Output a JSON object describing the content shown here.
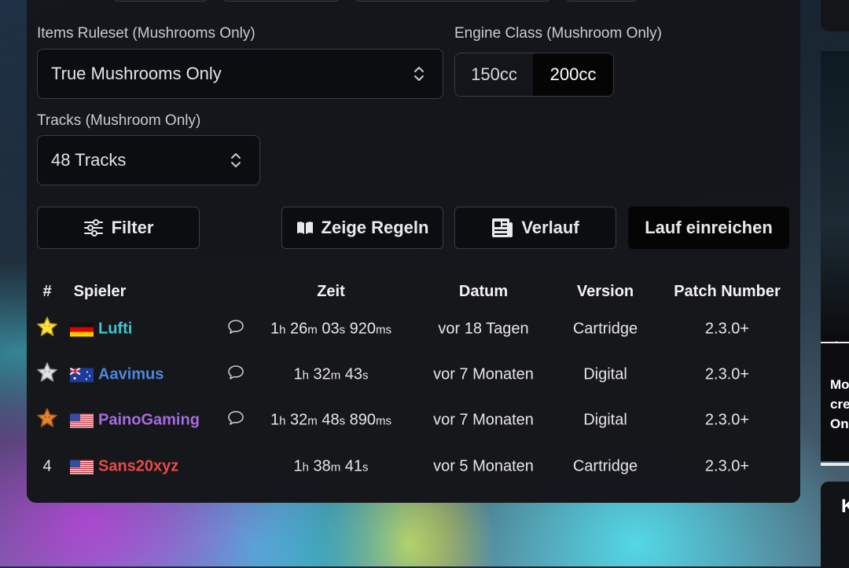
{
  "filters": {
    "items_label": "Items Ruleset (Mushrooms Only)",
    "items_value": "True Mushrooms Only",
    "engine_label": "Engine Class (Mushroom Only)",
    "engine_options": [
      "150cc",
      "200cc"
    ],
    "engine_selected": "200cc",
    "tracks_label": "Tracks (Mushroom Only)",
    "tracks_value": "48 Tracks"
  },
  "actions": {
    "filter": "Filter",
    "rules": "Zeige Regeln",
    "history": "Verlauf",
    "submit": "Lauf einreichen"
  },
  "table": {
    "headers": {
      "rank": "#",
      "player": "Spieler",
      "time": "Zeit",
      "date": "Datum",
      "version": "Version",
      "patch": "Patch Number"
    },
    "rows": [
      {
        "rank": "",
        "medal": "gold",
        "country": "DE",
        "player": "Lufti",
        "player_color": "#3fc7cf",
        "comment": true,
        "time": {
          "h": "1",
          "m": "26",
          "s": "03",
          "ms": "920"
        },
        "date": "vor 18 Tagen",
        "version": "Cartridge",
        "patch": "2.3.0+"
      },
      {
        "rank": "",
        "medal": "silver",
        "country": "AU",
        "player": "Aavimus",
        "player_color": "#4d86e0",
        "comment": true,
        "time": {
          "h": "1",
          "m": "32",
          "s": "43",
          "ms": ""
        },
        "date": "vor 7 Monaten",
        "version": "Digital",
        "patch": "2.3.0+"
      },
      {
        "rank": "",
        "medal": "bronze",
        "country": "US",
        "player": "PainoGaming",
        "player_color": "#a66be0",
        "comment": true,
        "time": {
          "h": "1",
          "m": "32",
          "s": "48",
          "ms": "890"
        },
        "date": "vor 7 Monaten",
        "version": "Digital",
        "patch": "2.3.0+"
      },
      {
        "rank": "4",
        "medal": "",
        "country": "US",
        "player": "Sans20xyz",
        "player_color": "#e84a4a",
        "comment": false,
        "time": {
          "h": "1",
          "m": "38",
          "s": "41",
          "ms": ""
        },
        "date": "vor 5 Monaten",
        "version": "Cartridge",
        "patch": "2.3.0+"
      }
    ]
  },
  "units": {
    "h": "h",
    "m": "m",
    "s": "s",
    "ms": "ms"
  },
  "side": {
    "card_text": [
      "Mo",
      "cre",
      "On"
    ],
    "card2_text": "K"
  },
  "icons": {
    "comment": "comment-icon",
    "filter": "sliders-icon",
    "rules": "book-icon",
    "history": "newspaper-icon",
    "chevron": "updown-chevron-icon"
  }
}
